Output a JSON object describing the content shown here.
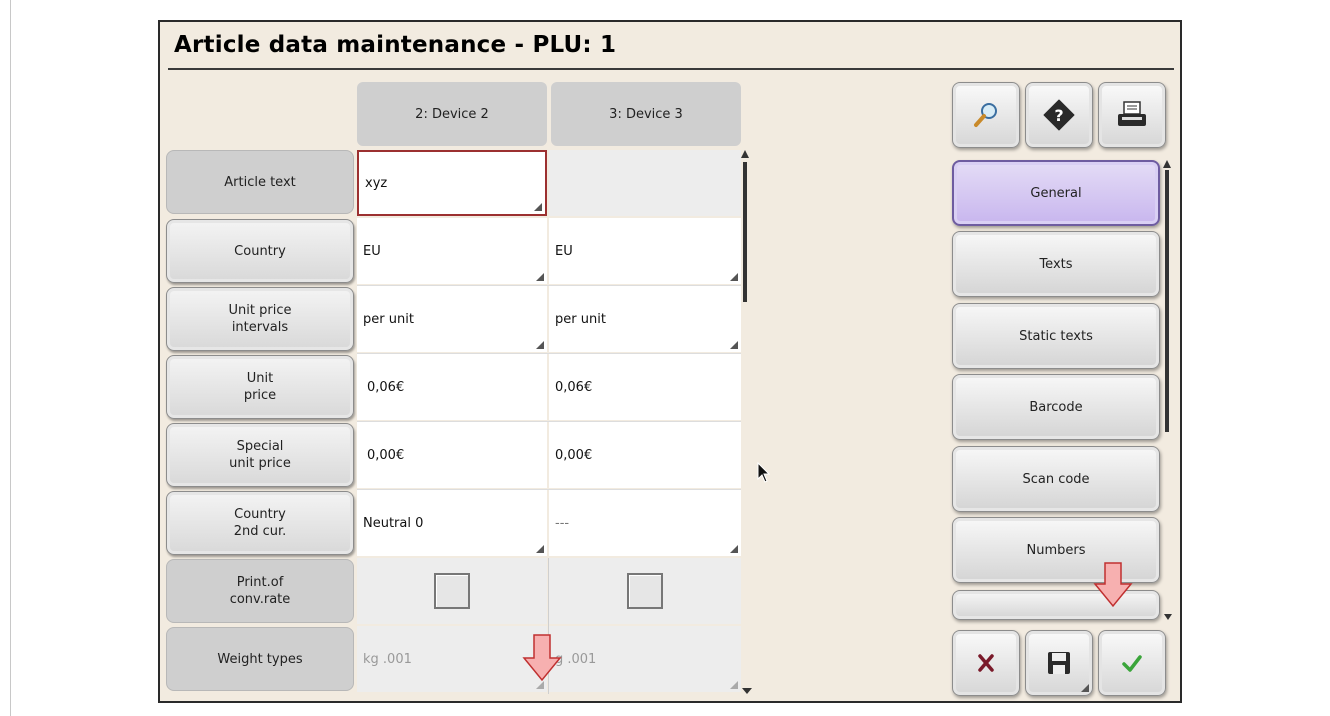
{
  "window": {
    "title": "Article data maintenance - PLU: 1"
  },
  "columns": [
    {
      "label": "2: Device 2"
    },
    {
      "label": "3: Device 3"
    }
  ],
  "rows": [
    {
      "label": "Article text",
      "values": [
        "xyz",
        ""
      ]
    },
    {
      "label": "Country",
      "values": [
        "EU",
        "EU"
      ]
    },
    {
      "label": "Unit price\nintervals",
      "values": [
        "per unit",
        "per unit"
      ]
    },
    {
      "label": "Unit\nprice",
      "values": [
        "0,06€",
        "0,06€"
      ]
    },
    {
      "label": "Special\nunit price",
      "values": [
        "0,00€",
        "0,00€"
      ]
    },
    {
      "label": "Country\n2nd cur.",
      "values": [
        "Neutral 0",
        "---"
      ]
    },
    {
      "label": "Print.of\nconv.rate",
      "values": [
        "",
        ""
      ],
      "checked": [
        false,
        false
      ]
    },
    {
      "label": "Weight types",
      "values": [
        "kg .001",
        "g .001"
      ]
    }
  ],
  "toolbar": {
    "icons": [
      "search-icon",
      "help-icon",
      "printer-icon"
    ]
  },
  "nav": {
    "items": [
      {
        "label": "General",
        "selected": true
      },
      {
        "label": "Texts"
      },
      {
        "label": "Static texts"
      },
      {
        "label": "Barcode"
      },
      {
        "label": "Scan code"
      },
      {
        "label": "Numbers"
      }
    ]
  },
  "actions": {
    "icons": [
      "cancel-icon",
      "save-icon",
      "confirm-icon"
    ]
  },
  "colors": {
    "window_bg": "#f2ebe0",
    "selected_nav": "#c8b6ee",
    "active_cell_border": "#9c3030",
    "hint_arrow": "#f7b0b0"
  }
}
